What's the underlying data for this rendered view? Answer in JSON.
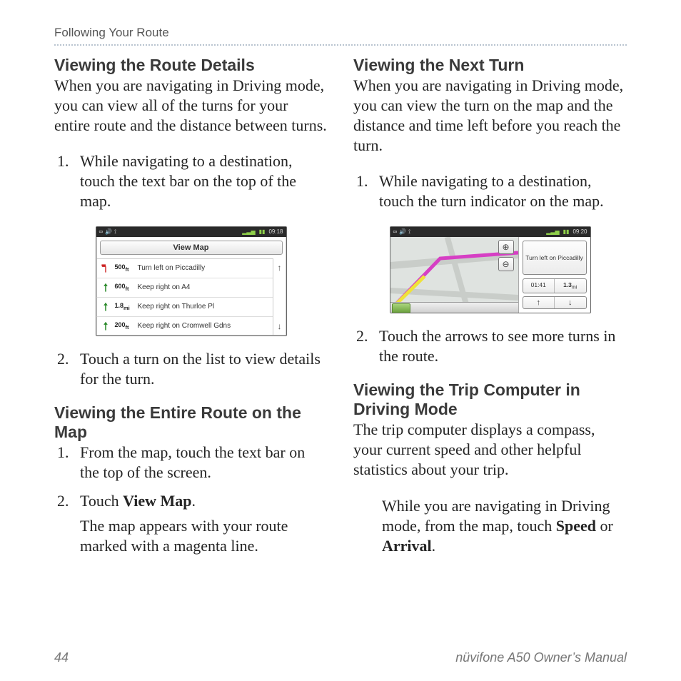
{
  "running_head": "Following Your Route",
  "left": {
    "h1": "Viewing the Route Details",
    "p1": "When you are navigating in Driving mode, you can view all of the turns for your entire route and the distance between turns.",
    "ol1_item1": "While navigating to a destination, touch the text bar on the top of the map.",
    "ol1_item2": "Touch a turn on the list to view details for the turn.",
    "h2": "Viewing the Entire Route on the Map",
    "ol2_item1": "From the map, touch the text bar on the top of the screen.",
    "ol2_item2_lead": "Touch ",
    "ol2_item2_bold": "View Map",
    "ol2_item2_tail": ".",
    "ol2_item2_sub": "The map appears with your route marked with a magenta line."
  },
  "right": {
    "h1": "Viewing the Next Turn",
    "p1": "When you are navigating in Driving mode, you can view the turn on the map and the distance and time left before you reach the turn.",
    "ol1_item1": "While navigating to a destination, touch the turn indicator on the map.",
    "ol1_item2": "Touch the arrows to see more turns in the route.",
    "h2": "Viewing the Trip Computer in Driving Mode",
    "p2": "The trip computer displays a compass, your current speed and other helpful statistics about your trip.",
    "indent_lead": "While you are navigating in Driving mode, from the map, touch ",
    "indent_bold1": "Speed",
    "indent_mid": " or ",
    "indent_bold2": "Arrival",
    "indent_tail": "."
  },
  "fig1": {
    "status_time": "09:18",
    "view_map": "View Map",
    "rows": [
      {
        "dist": "500",
        "unit": "ft",
        "text": "Turn left on Piccadilly",
        "type": "left"
      },
      {
        "dist": "600",
        "unit": "ft",
        "text": "Keep right on A4",
        "type": "up"
      },
      {
        "dist": "1.8",
        "unit": "mi",
        "text": "Keep right on Thurloe Pl",
        "type": "up"
      },
      {
        "dist": "200",
        "unit": "ft",
        "text": "Keep right on Cromwell Gdns",
        "type": "up"
      }
    ],
    "scroll_up": "↑",
    "scroll_down": "↓"
  },
  "fig2": {
    "status_time": "09:20",
    "turn_text": "Turn left on Piccadilly",
    "stat_time": "01:41",
    "stat_dist": "1.3",
    "stat_dist_unit": "mi",
    "arrow_up": "↑",
    "arrow_down": "↓",
    "zoom_in": "⊕",
    "zoom_out": "⊖"
  },
  "footer": {
    "page": "44",
    "manual": "nüvifone A50 Owner’s Manual"
  }
}
